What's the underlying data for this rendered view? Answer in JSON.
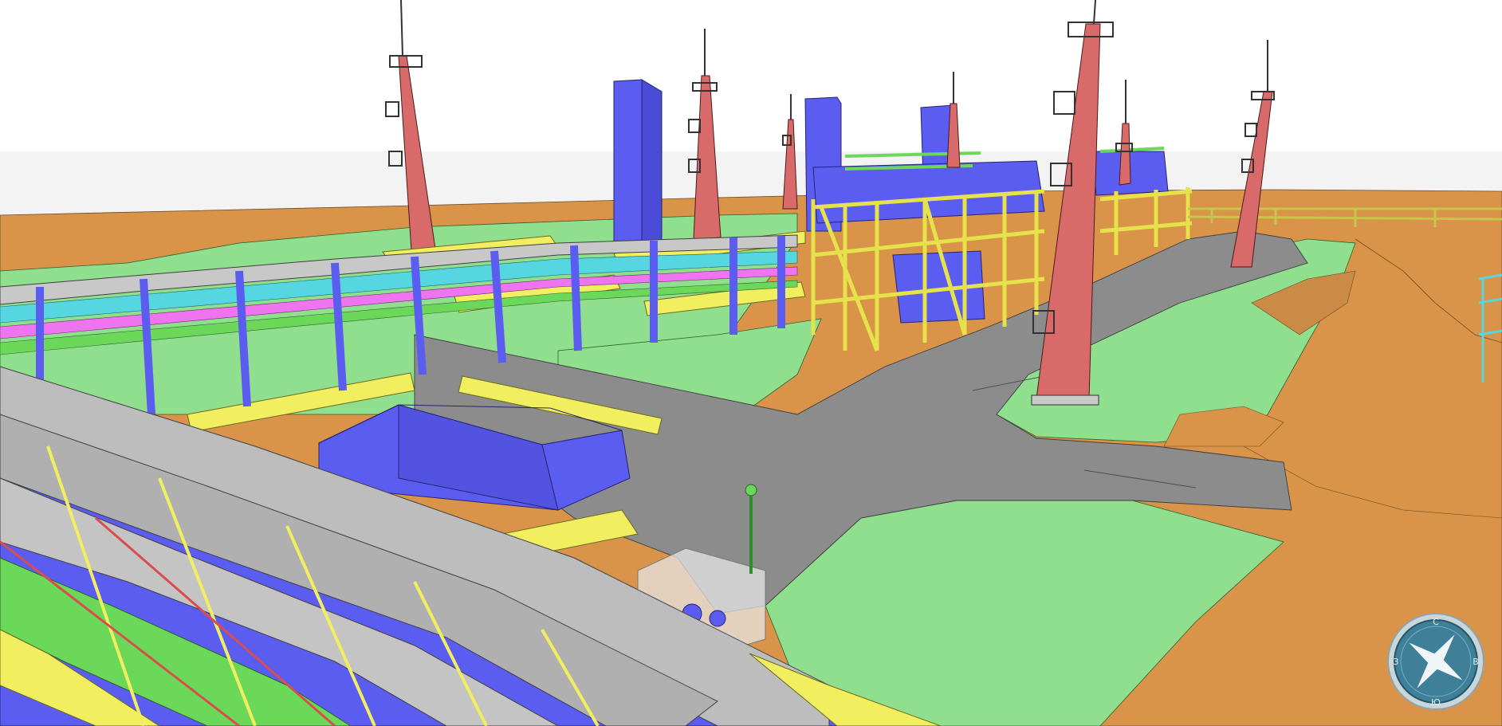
{
  "viewer": {
    "view_type": "3D model viewport",
    "background_color": "#ffffff",
    "horizon_color": "#f3f3f3"
  },
  "colors": {
    "terrain": "#d99449",
    "ground_green": "#8fdf8e",
    "road": "#8c8c8c",
    "structure_blue": "#5b5cf0",
    "steel_yellow": "#f1ef60",
    "tower_red": "#d96a6a",
    "pipe_gray": "#b8b8b8",
    "pipe_cyan": "#56d6e0",
    "pipe_magenta": "#ef74ef",
    "pipe_green": "#6bd85a"
  },
  "compass": {
    "icon": "compass-icon",
    "letters": {
      "north": "С",
      "east": "В",
      "south": "Ю",
      "west": "З"
    }
  }
}
